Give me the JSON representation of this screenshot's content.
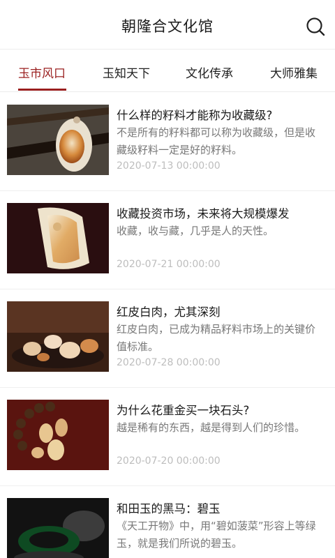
{
  "header": {
    "title": "朝隆合文化馆",
    "search_icon": "search-icon"
  },
  "tabs": [
    {
      "label": "玉市风口",
      "active": true
    },
    {
      "label": "玉知天下",
      "active": false
    },
    {
      "label": "文化传承",
      "active": false
    },
    {
      "label": "大师雅集",
      "active": false
    }
  ],
  "articles": [
    {
      "title": "什么样的籽料才能称为收藏级?",
      "desc": "不是所有的籽料都可以称为收藏级，但是收藏级籽料一定是好的籽料。",
      "date": "2020-07-13 00:00:00"
    },
    {
      "title": "收藏投资市场，未来将大规模爆发",
      "desc": "收藏，收与藏，几乎是人的天性。",
      "date": "2020-07-21 00:00:00"
    },
    {
      "title": "红皮白肉，尤其深刻",
      "desc": "红皮白肉，已成为精品籽料市场上的关键价值标准。",
      "date": "2020-07-28 00:00:00"
    },
    {
      "title": "为什么花重金买一块石头?",
      "desc": "越是稀有的东西，越是得到人们的珍惜。",
      "date": "2020-07-20 00:00:00"
    },
    {
      "title": "和田玉的黑马：碧玉",
      "desc": "《天工开物》中，用“碧如菠菜”形容上等绿玉，就是我们所说的碧玉。",
      "date": ""
    }
  ]
}
